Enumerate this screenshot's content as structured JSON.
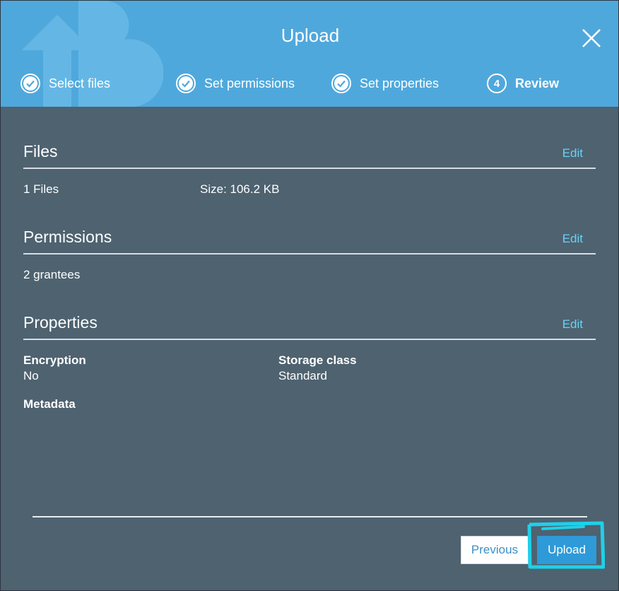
{
  "header": {
    "title": "Upload",
    "steps": [
      {
        "label": "Select files",
        "state": "done"
      },
      {
        "label": "Set permissions",
        "state": "done"
      },
      {
        "label": "Set properties",
        "state": "done"
      },
      {
        "label": "Review",
        "state": "active",
        "number": "4"
      }
    ]
  },
  "files": {
    "title": "Files",
    "edit_label": "Edit",
    "count": "1 Files",
    "size": "Size: 106.2 KB"
  },
  "permissions": {
    "title": "Permissions",
    "edit_label": "Edit",
    "grantees": "2 grantees"
  },
  "properties": {
    "title": "Properties",
    "edit_label": "Edit",
    "encryption_label": "Encryption",
    "encryption_value": "No",
    "storage_label": "Storage class",
    "storage_value": "Standard",
    "metadata_label": "Metadata"
  },
  "footer": {
    "previous_label": "Previous",
    "upload_label": "Upload"
  },
  "colors": {
    "header_bg": "#4fa8dc",
    "body_bg": "#4e6270",
    "link": "#6ad2f5",
    "primary_button": "#2f9ad8",
    "annotation": "#1fd0e8"
  }
}
